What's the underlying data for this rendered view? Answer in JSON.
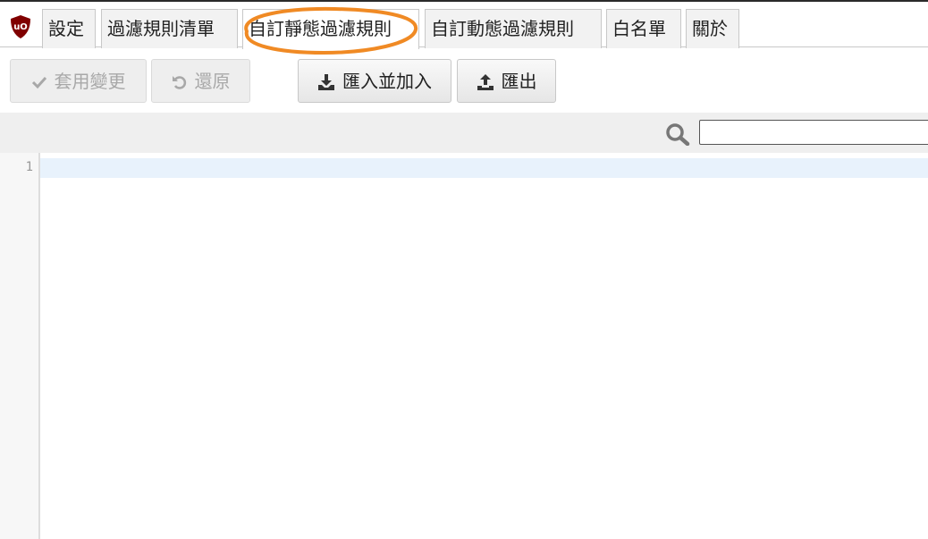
{
  "tabs": [
    {
      "label": "設定"
    },
    {
      "label": "過濾規則清單"
    },
    {
      "label": "自訂靜態過濾規則",
      "active": true
    },
    {
      "label": "自訂動態過濾規則"
    },
    {
      "label": "白名單"
    },
    {
      "label": "關於"
    }
  ],
  "logo": {
    "text": "uO",
    "color": "#800000"
  },
  "annotation_color": "#f08a24",
  "toolbar": {
    "apply_label": "套用變更",
    "revert_label": "還原",
    "import_label": "匯入並加入",
    "export_label": "匯出"
  },
  "search": {
    "value": "",
    "placeholder": ""
  },
  "editor": {
    "line_numbers": [
      "1"
    ]
  }
}
